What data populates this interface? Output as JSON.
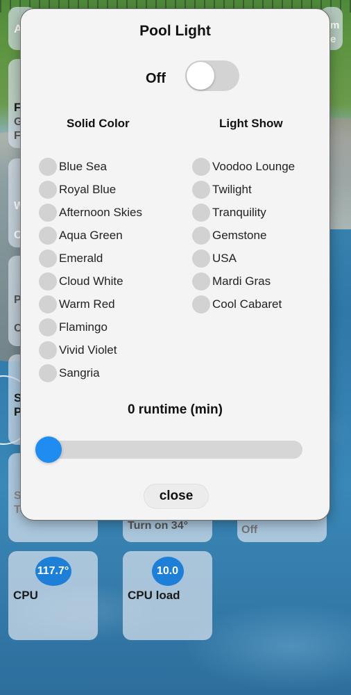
{
  "modal": {
    "title": "Pool Light",
    "power_state_label": "Off",
    "power_on": false,
    "solid_color_header": "Solid Color",
    "light_show_header": "Light Show",
    "solid_colors": [
      "Blue Sea",
      "Royal Blue",
      "Afternoon Skies",
      "Aqua Green",
      "Emerald",
      "Cloud White",
      "Warm Red",
      "Flamingo",
      "Vivid Violet",
      "Sangria"
    ],
    "light_shows": [
      "Voodoo Lounge",
      "Twilight",
      "Tranquility",
      "Gemstone",
      "USA",
      "Mardi Gras",
      "Cool Cabaret"
    ],
    "runtime_value": "0",
    "runtime_label": "runtime (min)",
    "slider_fraction": 0,
    "close_label": "close"
  },
  "background_tiles": {
    "top_left_letter": "A",
    "top_right_letters": "m",
    "top_right_letters_2": "e",
    "tile_f_letter": "F",
    "tile_f_sub1": "G",
    "tile_f_sub2": "F",
    "tile_w_letter": "W",
    "tile_w_sub": "C",
    "tile_p_letter": "P",
    "tile_p_sub": "C",
    "tile_s_letter": "S",
    "tile_s_letter2": "P",
    "tile_s2_letter": "S",
    "tile_s2_sub": "Te",
    "turn_on_label": "Turn on 34°",
    "off_label": "Off",
    "cpu_temp_value": "117.7°",
    "cpu_temp_label": "CPU",
    "cpu_load_value": "10.0",
    "cpu_load_label": "CPU load"
  },
  "colors": {
    "accent": "#1e8cf0",
    "modal_bg": "#f4f4f4",
    "radio": "#d2d2d2"
  }
}
